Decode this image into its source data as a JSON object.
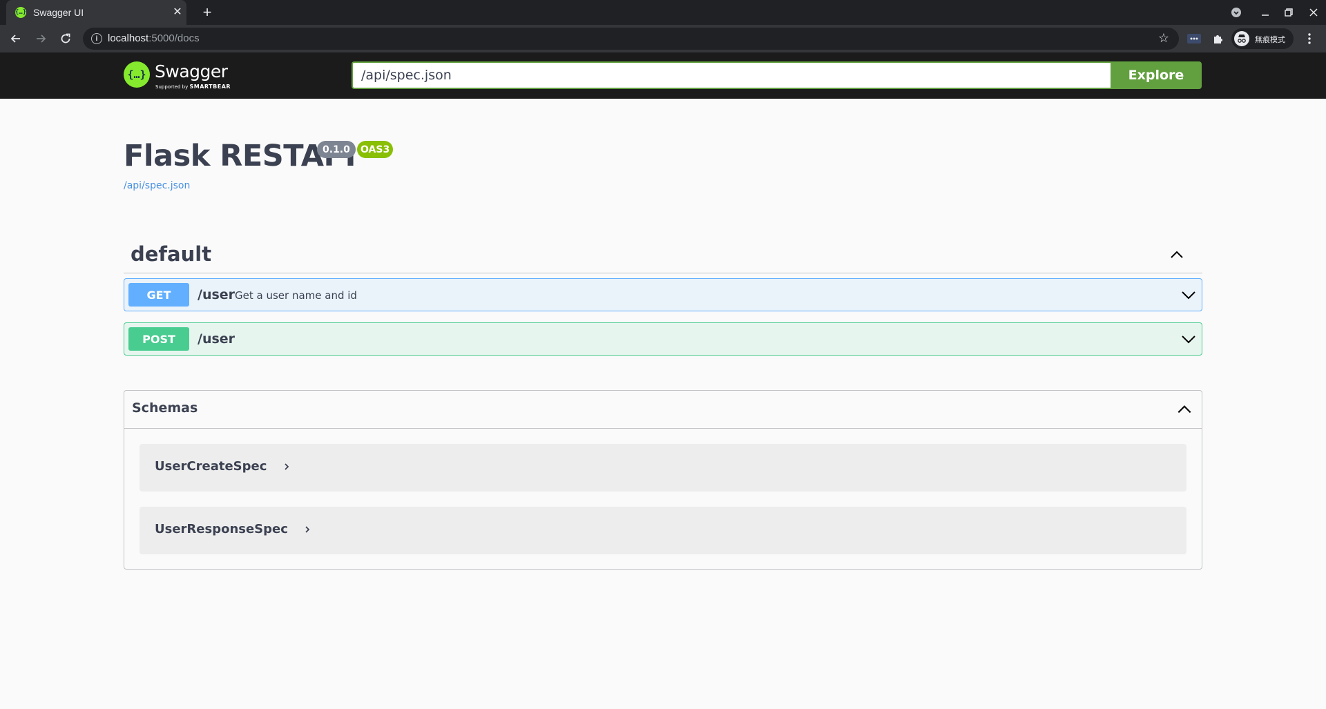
{
  "browser": {
    "tab_title": "Swagger UI",
    "favicon_glyph": "{…}",
    "url_host": "localhost",
    "url_rest": ":5000/docs",
    "profile_label": "無痕模式"
  },
  "swagger": {
    "logo_name": "Swagger",
    "logo_sub_prefix": "Supported by",
    "logo_sub_brand": "SMARTBEAR",
    "logo_mark_glyph": "{…}",
    "spec_url": "/api/spec.json",
    "explore_label": "Explore"
  },
  "info": {
    "title": "Flask RESTAPI",
    "version": "0.1.0",
    "oas": "OAS3",
    "spec_link": "/api/spec.json"
  },
  "tag": {
    "name": "default"
  },
  "operations": [
    {
      "method": "GET",
      "path": "/user",
      "summary": "Get a user name and id"
    },
    {
      "method": "POST",
      "path": "/user",
      "summary": ""
    }
  ],
  "schemas": {
    "title": "Schemas",
    "items": [
      "UserCreateSpec",
      "UserResponseSpec"
    ]
  },
  "colors": {
    "get": "#61affe",
    "post": "#49cc90",
    "swagger_green": "#62a03f",
    "logo_green": "#85ea2d"
  }
}
